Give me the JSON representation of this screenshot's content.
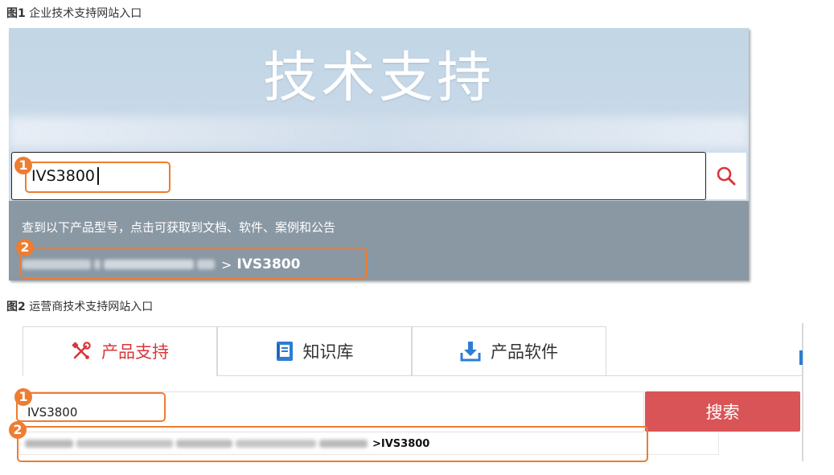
{
  "captions": {
    "fig1_no": "图1",
    "fig1_text": "企业技术支持网站入口",
    "fig2_no": "图2",
    "fig2_text": "运营商技术支持网站入口"
  },
  "fig1": {
    "hero_title": "技术支持",
    "search_value": "IVS3800",
    "search_icon": "search-icon",
    "results_hint": "查到以下产品型号，点击可获取到文档、软件、案例和公告",
    "result_separator": ">",
    "result_model": "IVS3800",
    "marker_1": "1",
    "marker_2": "2",
    "colors": {
      "search_icon": "#d9363a",
      "result_band": "#8a98a4",
      "marker": "#ed7d31"
    }
  },
  "fig2": {
    "tabs": [
      {
        "label": "产品支持",
        "icon": "tools-icon",
        "active": true
      },
      {
        "label": "知识库",
        "icon": "book-icon",
        "active": false
      },
      {
        "label": "产品软件",
        "icon": "download-icon",
        "active": false
      }
    ],
    "search_value": "IVS3800",
    "search_button": "搜索",
    "suggest_model": ">IVS3800",
    "marker_1": "1",
    "marker_2": "2",
    "colors": {
      "active_tab": "#d9363a",
      "search_button": "#d95456",
      "book_icon": "#2d7dd2",
      "download_icon": "#2d7dd2"
    }
  }
}
